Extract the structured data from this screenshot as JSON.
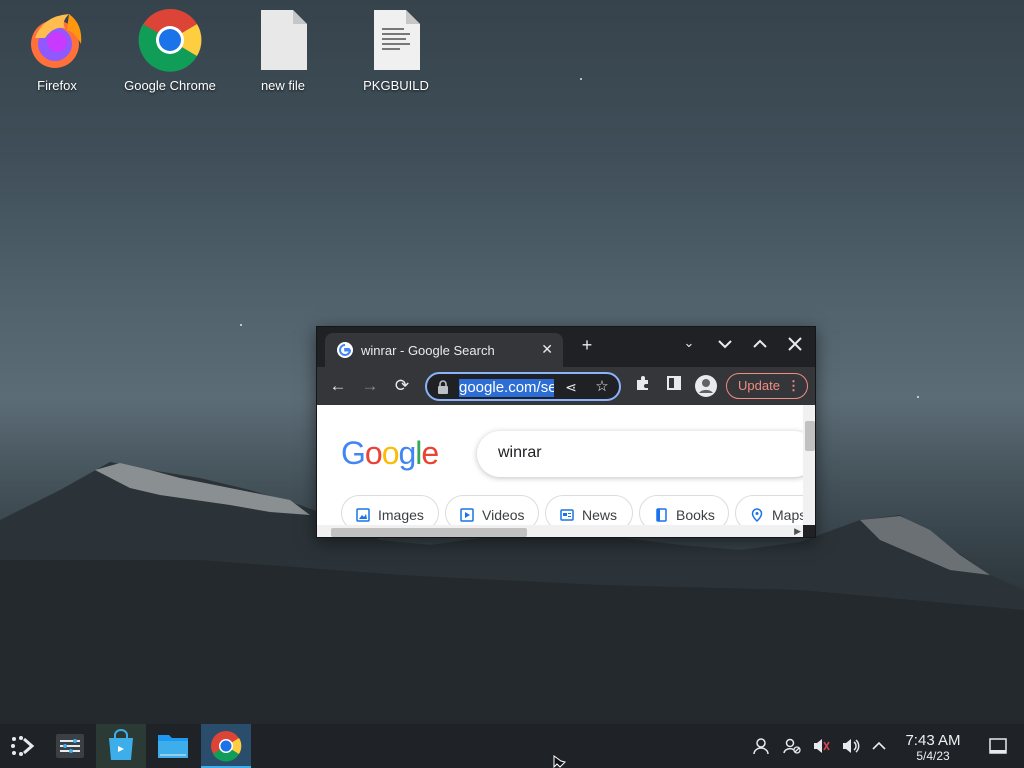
{
  "desktop": {
    "icons": [
      {
        "label": "Firefox",
        "icon": "firefox-icon"
      },
      {
        "label": "Google Chrome",
        "icon": "chrome-icon"
      },
      {
        "label": "new file",
        "icon": "blank-file-icon"
      },
      {
        "label": "PKGBUILD",
        "icon": "text-file-icon"
      }
    ]
  },
  "browser": {
    "tab_title": "winrar - Google Search",
    "url": "google.com/se",
    "update_label": "Update",
    "google_logo": "Google",
    "search_query": "winrar",
    "chips": [
      "Images",
      "Videos",
      "News",
      "Books",
      "Maps"
    ],
    "accent_color": "#8ab4f8",
    "update_color": "#f28b82"
  },
  "taskbar": {
    "time": "7:43 AM",
    "date": "5/4/23",
    "active_task": "chrome",
    "tasks": [
      "app-launcher-icon",
      "system-settings-icon",
      "discover-store-icon",
      "file-manager-icon",
      "chrome-icon"
    ],
    "tray": [
      "user-icon",
      "network-icon",
      "mute-icon",
      "volume-icon",
      "tray-expand-icon",
      "show-desktop-icon"
    ]
  }
}
